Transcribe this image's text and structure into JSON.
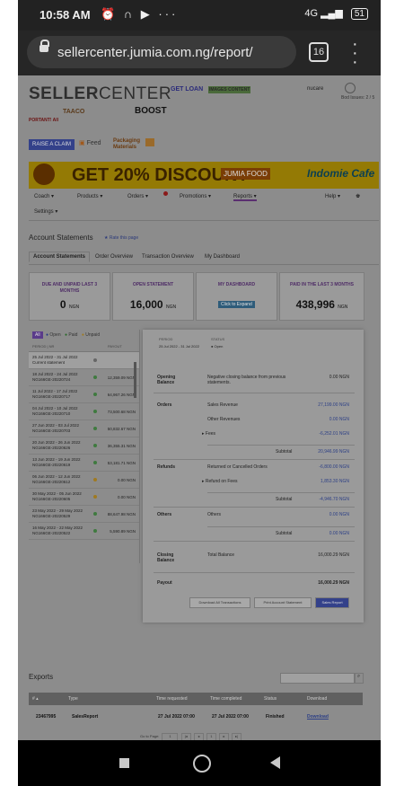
{
  "status": {
    "time": "10:58 AM",
    "icons": "⏰ ∩ ▶ ···",
    "network": "4G",
    "battery": "51"
  },
  "browser": {
    "url": "sellercenter.jumia.com.ng/report/",
    "tabs": "16"
  },
  "header": {
    "logo_a": "SELLER",
    "logo_b": "CENTER",
    "promo_loan": "GET LOAN",
    "promo_images": "IMAGES CONTENT",
    "promo_taaco": "TAACO",
    "promo_boost": "BOOST",
    "promo_portant": "PORTANT! All",
    "user": "nucare",
    "user_sub": "Bod Issues: 2 / 5"
  },
  "actions": {
    "claim": "RAISE A CLAIM",
    "feed": "Feed",
    "packaging": "Packaging Materials"
  },
  "banner": {
    "text": "GET 20% DISCOUNT",
    "food": "JUMIA FOOD",
    "cafe": "Indomie Cafe"
  },
  "nav": {
    "coach": "Coach ▾",
    "products": "Products ▾",
    "orders": "Orders ▾",
    "promotions": "Promotions ▾",
    "reports": "Reports ▾",
    "help": "Help ▾",
    "settings": "Settings ▾"
  },
  "page_title": "Account Statements",
  "rate_link": "★ Rate this page",
  "tabs": [
    "Account Statements",
    "Order Overview",
    "Transaction Overview",
    "My Dashboard"
  ],
  "cards": [
    {
      "label": "DUE AND UNPAID LAST 3 MONTHS",
      "value": "0",
      "unit": "NGN"
    },
    {
      "label": "OPEN STATEMENT",
      "value": "16,000",
      "unit": "NGN"
    },
    {
      "label": "MY DASHBOARD",
      "button": "Click to Expand"
    },
    {
      "label": "PAID IN THE LAST 3 MONTHS",
      "value": "438,996",
      "unit": "NGN"
    }
  ],
  "filters": {
    "all": "All",
    "open": "Open",
    "paid": "Paid",
    "unpaid": "Unpaid"
  },
  "list_head": {
    "period": "PERIOD | NR",
    "payout": "PAYOUT"
  },
  "statements": [
    {
      "period": "25 Jul 2022 - 31 Jul 2022",
      "id": "Current statement",
      "amount": "",
      "color": "#666"
    },
    {
      "period": "18 Jul 2022 - 24 Jul 2022",
      "id": "NG166GE-20220724",
      "amount": "12,359.09 NGN",
      "color": "#3f7a3f"
    },
    {
      "period": "11 Jul 2022 - 17 Jul 2022",
      "id": "NG166GE-20220717",
      "amount": "64,967.26 NGN",
      "color": "#3f7a3f"
    },
    {
      "period": "04 Jul 2022 - 10 Jul 2022",
      "id": "NG166GE-20220710",
      "amount": "73,500.68 NGN",
      "color": "#3f7a3f"
    },
    {
      "period": "27 Jun 2022 - 03 Jul 2022",
      "id": "NG166GE-20220703",
      "amount": "50,832.67 NGN",
      "color": "#3f7a3f"
    },
    {
      "period": "20 Jun 2022 - 26 Jun 2022",
      "id": "NG166GE-20220626",
      "amount": "36,355.31 NGN",
      "color": "#3f7a3f"
    },
    {
      "period": "13 Jun 2022 - 19 Jun 2022",
      "id": "NG166GE-20220619",
      "amount": "53,181.71 NGN",
      "color": "#3f7a3f"
    },
    {
      "period": "06 Jun 2022 - 12 Jun 2022",
      "id": "NG166GE-20220612",
      "amount": "0.00 NGN",
      "color": "#a07a20"
    },
    {
      "period": "30 May 2022 - 05 Jun 2022",
      "id": "NG166GE-20220605",
      "amount": "0.00 NGN",
      "color": "#a07a20"
    },
    {
      "period": "23 May 2022 - 29 May 2022",
      "id": "NG166GE-20220529",
      "amount": "88,647.98 NGN",
      "color": "#3f7a3f"
    },
    {
      "period": "16 May 2022 - 22 May 2022",
      "id": "NG166GE-20220522",
      "amount": "5,590.89 NGN",
      "color": "#3f7a3f"
    }
  ],
  "detail": {
    "period_head": "PERIOD",
    "status_head": "STATUS",
    "period": "25 Jul 2022 - 31 Jul 2022",
    "status": "● Open",
    "opening_label": "Opening Balance",
    "opening_desc": "Negative closing balance from previous statements.",
    "opening_val": "0.00 NGN",
    "orders_label": "Orders",
    "sales_label": "Sales Revenue",
    "sales_val": "27,199.00 NGN",
    "other_label": "Other Revenues",
    "other_val": "0.00 NGN",
    "fees_label": "▸ Fees",
    "fees_val": "-6,252.01 NGN",
    "subtotal_label": "Subtotal",
    "orders_subtotal": "20,946.99 NGN",
    "refunds_label": "Refunds",
    "returned_label": "Returned or Cancelled Orders",
    "returned_val": "-6,800.00 NGN",
    "refund_fees_label": "▸ Refund on Fees",
    "refund_fees_val": "1,853.30 NGN",
    "refunds_subtotal": "-4,946.70 NGN",
    "others_label": "Others",
    "others_sub": "Others",
    "others_val": "0.00 NGN",
    "others_subtotal": "0.00 NGN",
    "closing_label": "Closing Balance",
    "total_label": "Total Balance",
    "total_val": "16,000.29 NGN",
    "payout_label": "Payout",
    "payout_val": "16,000.29 NGN",
    "btn_download": "Download All Transactions",
    "btn_print": "Print Account Statement",
    "btn_sales": "Sales Report"
  },
  "exports": {
    "title": "Exports",
    "cols": [
      "# ▴",
      "Type",
      "Time requested",
      "Time completed",
      "Status",
      "Download"
    ],
    "row": {
      "id": "23467995",
      "type": "SalesReport",
      "requested": "27 Jul 2022 07:00",
      "completed": "27 Jul 2022 07:00",
      "status": "Finished",
      "download": "Download"
    },
    "pager_label": "Go to Page:",
    "pager_value": "1"
  }
}
